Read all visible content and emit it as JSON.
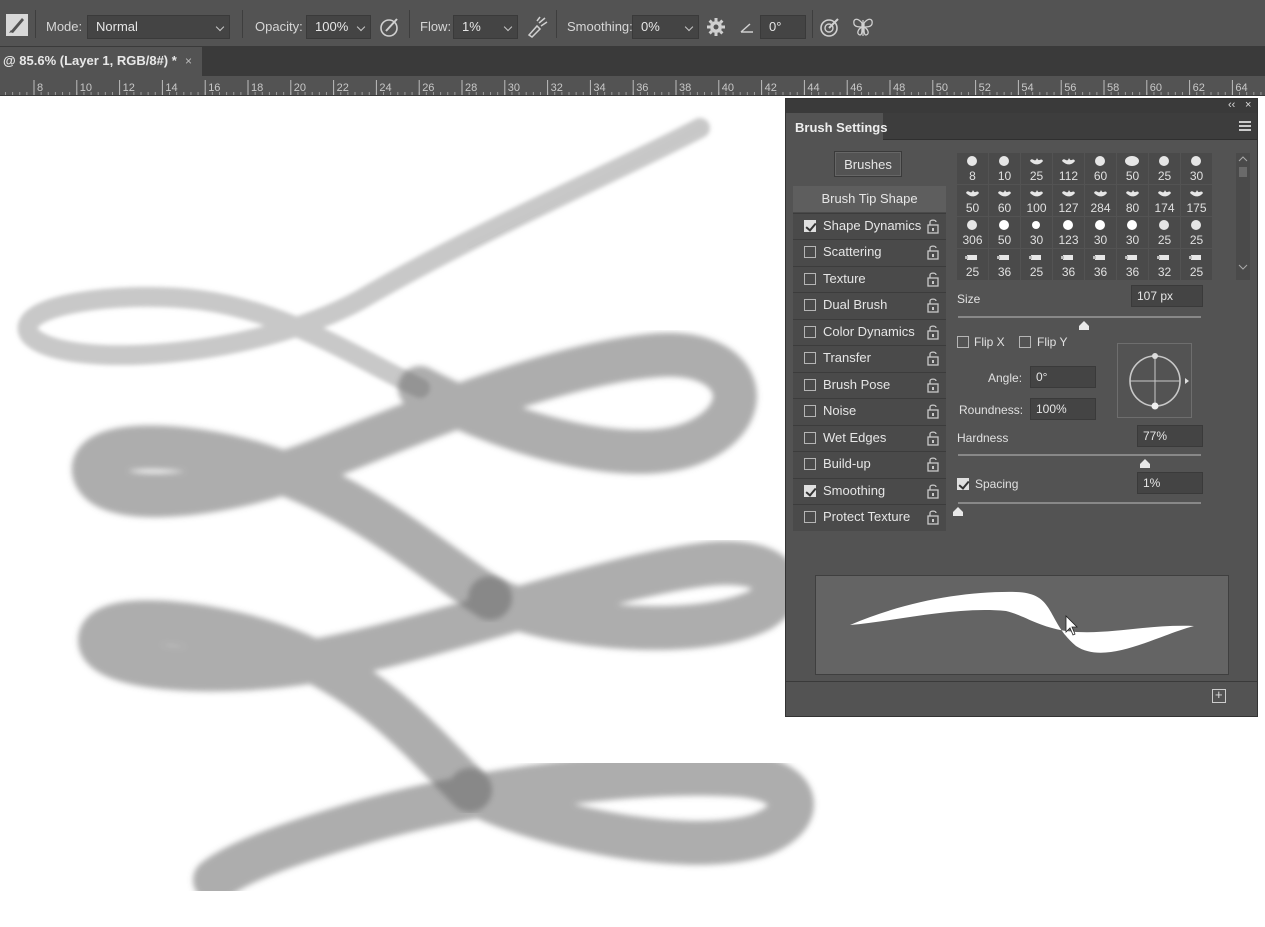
{
  "options_bar": {
    "tool_icon": "brush-tool-icon",
    "mode_label": "Mode:",
    "mode_value": "Normal",
    "opacity_label": "Opacity:",
    "opacity_value": "100%",
    "flow_label": "Flow:",
    "flow_value": "1%",
    "smoothing_label": "Smoothing:",
    "smoothing_value": "0%",
    "angle_value": "0°",
    "icons": [
      "pressure-opacity-icon",
      "airbrush-icon",
      "smoothing-settings-gear-icon",
      "angle-icon",
      "pressure-size-icon",
      "symmetry-butterfly-icon"
    ]
  },
  "document_tab": {
    "title": "@ 85.6% (Layer 1, RGB/8#) *",
    "close_label": "×"
  },
  "ruler": {
    "ticks": [
      "8",
      "10",
      "12",
      "14",
      "16",
      "18",
      "20",
      "22",
      "24",
      "26",
      "28",
      "30",
      "32",
      "34",
      "36",
      "38",
      "40",
      "42",
      "44",
      "46",
      "48",
      "50",
      "52",
      "54",
      "56",
      "58",
      "60",
      "62",
      "64"
    ]
  },
  "brush_panel": {
    "title": "Brush Settings",
    "collapse_label": "‹‹",
    "close_label": "×",
    "brushes_button": "Brushes",
    "options": [
      {
        "label": "Brush Tip Shape",
        "checked": null,
        "lock": false,
        "selected": true
      },
      {
        "label": "Shape Dynamics",
        "checked": true,
        "lock": true
      },
      {
        "label": "Scattering",
        "checked": false,
        "lock": true
      },
      {
        "label": "Texture",
        "checked": false,
        "lock": true
      },
      {
        "label": "Dual Brush",
        "checked": false,
        "lock": true
      },
      {
        "label": "Color Dynamics",
        "checked": false,
        "lock": true
      },
      {
        "label": "Transfer",
        "checked": false,
        "lock": true
      },
      {
        "label": "Brush Pose",
        "checked": false,
        "lock": true
      },
      {
        "label": "Noise",
        "checked": false,
        "lock": true
      },
      {
        "label": "Wet Edges",
        "checked": false,
        "lock": true
      },
      {
        "label": "Build-up",
        "checked": false,
        "lock": true
      },
      {
        "label": "Smoothing",
        "checked": true,
        "lock": true
      },
      {
        "label": "Protect Texture",
        "checked": false,
        "lock": true
      }
    ],
    "presets": [
      [
        "8",
        "10",
        "25",
        "112",
        "60",
        "50",
        "25",
        "30"
      ],
      [
        "50",
        "60",
        "100",
        "127",
        "284",
        "80",
        "174",
        "175"
      ],
      [
        "306",
        "50",
        "30",
        "123",
        "30",
        "30",
        "25",
        "25"
      ],
      [
        "25",
        "36",
        "25",
        "36",
        "36",
        "36",
        "32",
        "25"
      ]
    ],
    "size_label": "Size",
    "size_value": "107 px",
    "size_slider": 0.52,
    "flip_x_label": "Flip X",
    "flip_y_label": "Flip Y",
    "flip_x": false,
    "flip_y": false,
    "angle_label": "Angle:",
    "angle_value": "0°",
    "roundness_label": "Roundness:",
    "roundness_value": "100%",
    "hardness_label": "Hardness",
    "hardness_value": "77%",
    "hardness_slider": 0.77,
    "spacing_label": "Spacing",
    "spacing_checked": true,
    "spacing_value": "1%",
    "spacing_slider": 0.0
  },
  "colors": {
    "panel_bg": "#535353",
    "dark_bg": "#3a3a3a",
    "stroke": "#5a5a5a"
  }
}
